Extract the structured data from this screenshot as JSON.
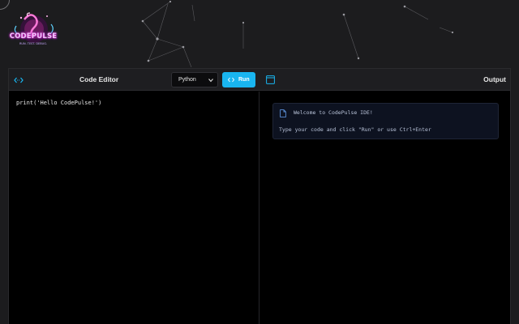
{
  "logo": {
    "text": "CODEPULSE",
    "tagline": "RUN. TEST. DEBUG."
  },
  "icons": {
    "code": "code-brackets-icon",
    "run": "code-arrows-icon",
    "terminal": "terminal-window-icon",
    "document": "document-icon",
    "chevron": "chevron-down-icon"
  },
  "editor": {
    "title": "Code Editor",
    "language_selected": "Python",
    "code": "print('Hello CodePulse!')"
  },
  "toolbar": {
    "run_label": "Run"
  },
  "output": {
    "title": "Output",
    "welcome": "Welcome to CodePulse IDE!",
    "hint": "Type your code and click \"Run\" or use Ctrl+Enter"
  },
  "colors": {
    "accent": "#19b5f0",
    "background": "#1c1c1e",
    "panel": "#000000",
    "output_box": "#0d1220"
  }
}
